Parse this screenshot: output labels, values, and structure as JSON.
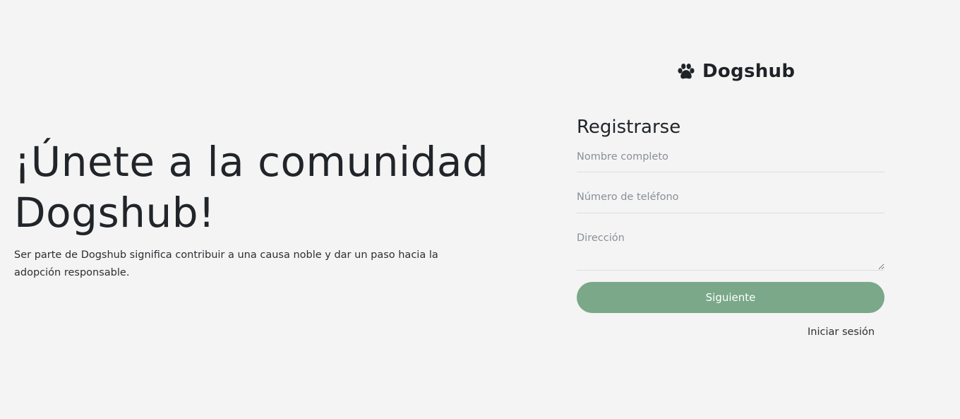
{
  "hero": {
    "heading": "¡Únete a la comunidad Dogshub!",
    "description": "Ser parte de Dogshub significa contribuir a una causa noble y dar un paso hacia la adopción responsable."
  },
  "brand": {
    "name": "Dogshub",
    "icon": "paw-icon"
  },
  "form": {
    "title": "Registrarse",
    "fields": {
      "full_name": {
        "placeholder": "Nombre completo",
        "value": ""
      },
      "phone": {
        "placeholder": "Número de teléfono",
        "value": ""
      },
      "address": {
        "placeholder": "Dirección",
        "value": ""
      }
    },
    "next_button": "Siguiente",
    "login_link": "Iniciar sesión"
  },
  "colors": {
    "background": "#f4f4f4",
    "accent": "#7aa888",
    "text": "#212529"
  }
}
